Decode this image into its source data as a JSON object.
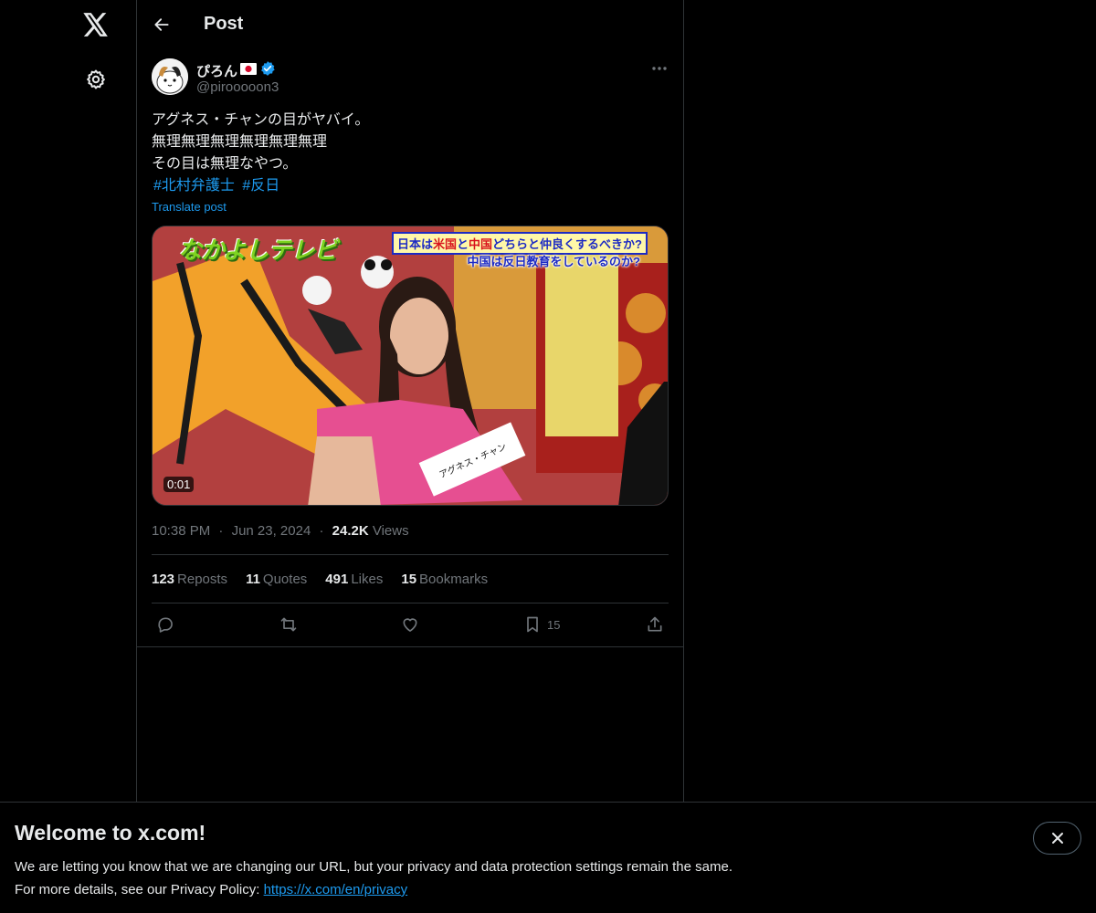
{
  "header": {
    "title": "Post"
  },
  "author": {
    "display_name": "ぴろん",
    "handle": "@pirooooon3",
    "flag": "🇯🇵"
  },
  "tweet": {
    "lines": [
      "アグネス・チャンの目がヤバイ。",
      "無理無理無理無理無理無理",
      "その目は無理なやつ。"
    ],
    "hashtags": [
      "#北村弁護士",
      "#反日"
    ],
    "translate_label": "Translate post"
  },
  "media": {
    "duration": "0:01",
    "caption_line1_a": "日本は",
    "caption_line1_b": "米国",
    "caption_line1_c": "と",
    "caption_line1_d": "中国",
    "caption_line1_e": "どちらと仲良くするべきか?",
    "caption_line2": "中国は反日教育をしているのか?",
    "show_logo": "なかよしテレビ",
    "name_tag": "アグネス・チャン"
  },
  "meta": {
    "time": "10:38 PM",
    "date": "Jun 23, 2024",
    "views_count": "24.2K",
    "views_label": "Views",
    "separator": "·"
  },
  "stats": {
    "reposts": {
      "num": "123",
      "label": "Reposts"
    },
    "quotes": {
      "num": "11",
      "label": "Quotes"
    },
    "likes": {
      "num": "491",
      "label": "Likes"
    },
    "bookmarks": {
      "num": "15",
      "label": "Bookmarks"
    }
  },
  "actions": {
    "bookmark_count": "15"
  },
  "banner": {
    "title": "Welcome to x.com!",
    "line1": "We are letting you know that we are changing our URL, but your privacy and data protection settings remain the same.",
    "line2_prefix": "For more details, see our Privacy Policy: ",
    "link": "https://x.com/en/privacy"
  },
  "colors": {
    "accent": "#1d9bf0",
    "background": "#000000",
    "text": "#e7e9ea",
    "muted": "#71767b",
    "border": "#2f3336"
  }
}
